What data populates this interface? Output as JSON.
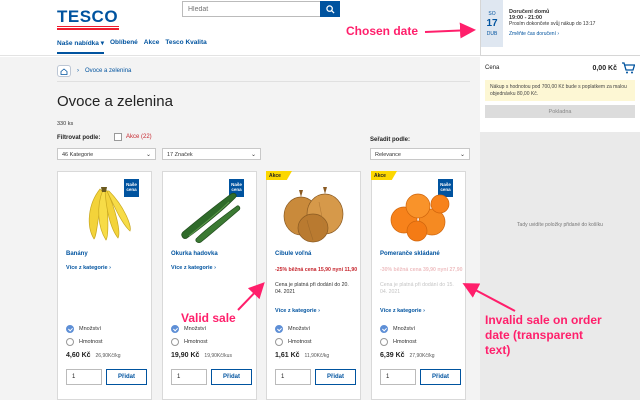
{
  "header": {
    "logo": "TESCO",
    "search_placeholder": "Hledat",
    "nav": [
      {
        "label": "Naše nabídka ▾"
      },
      {
        "label": "Oblíbené"
      },
      {
        "label": "Akce"
      },
      {
        "label": "Tesco Kvalita"
      }
    ]
  },
  "delivery": {
    "dow": "SO",
    "day": "17",
    "month": "DUB",
    "title": "Doručení domů",
    "time": "19:00 - 21:00",
    "note": "Prosím dokončete svůj nákup do 13:17",
    "change_link": "Změňte čas doručení ›"
  },
  "cart": {
    "label": "Cena",
    "amount": "0,00 Kč",
    "note": "Nákup s hodnotou pod 700,00 Kč bude s poplatkem za malou objednávku 80,00 Kč.",
    "checkout": "Pokladna",
    "empty_text": "Tady uvidíte položky přidané do košíku"
  },
  "main": {
    "breadcrumb": "Ovoce a zelenina",
    "title": "Ovoce a zelenina",
    "count": "330 ks",
    "filter_label": "Filtrovat podle:",
    "akce_filter": "Akce (22)",
    "category_select": "46 Kategorie",
    "brand_select": "17 Značek",
    "sort_label": "Seřadit podle:",
    "sort_select": "Relevance"
  },
  "products": [
    {
      "name": "Banány",
      "more": "Více z kategorie ›",
      "nase_cena": "Naše cena",
      "radio1": "Množství",
      "radio2": "Hmotnost",
      "price": "4,60 Kč",
      "unit_price": "26,90Kč/kg",
      "qty": "1",
      "add": "Přidat"
    },
    {
      "name": "Okurka hadovka",
      "more": "Více z kategorie ›",
      "nase_cena": "Naše cena",
      "radio1": "Množství",
      "radio2": "Hmotnost",
      "price": "19,90 Kč",
      "unit_price": "19,90Kč/kus",
      "qty": "1",
      "add": "Přidat"
    },
    {
      "badge": "Akce",
      "name": "Cibule voľná",
      "more": "Více z kategorie ›",
      "promo": "-25% běžná cena 15,90 nyní 11,90",
      "promo_note": "Cena je platná při dodání do 20. 04. 2021",
      "radio1": "Množství",
      "radio2": "Hmotnost",
      "price": "1,61 Kč",
      "unit_price": "11,90Kč/kg",
      "qty": "1",
      "add": "Přidat"
    },
    {
      "badge": "Akce",
      "name": "Pomeranče skládané",
      "more": "Více z kategorie ›",
      "nase_cena": "Naše cena",
      "promo": "-30% běžná cena 39,90 nyní 27,90",
      "promo_note": "Cena je platná při dodání do 15. 04. 2021",
      "radio1": "Množství",
      "radio2": "Hmotnost",
      "price": "6,39 Kč",
      "unit_price": "27,90Kč/kg",
      "qty": "1",
      "add": "Přidat"
    }
  ],
  "annotations": {
    "chosen_date": "Chosen date",
    "valid_sale": "Valid sale",
    "invalid_sale": "Invalid sale on order date (transparent text)"
  },
  "colors": {
    "brand_blue": "#00539f",
    "brand_red": "#ee1c2e",
    "sale_red": "#c6262e",
    "annotation_pink": "#ff1f6b",
    "akce_yellow": "#fcd700"
  }
}
